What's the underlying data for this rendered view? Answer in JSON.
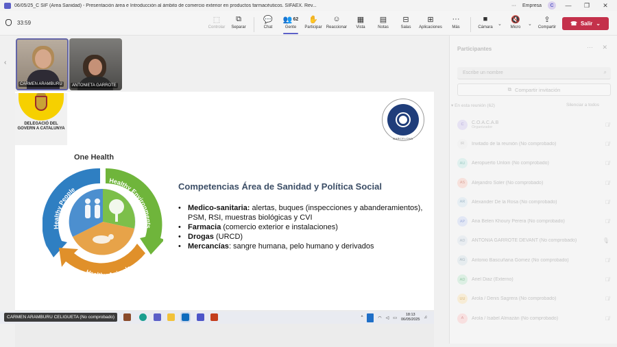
{
  "window": {
    "title": "06/05/25_C SIF (Área Sanidad) - Presentación área e Introducción al ámbito de comercio exterior en productos farmacéuticos. SIFAEX. Rev...",
    "org": "Empresa",
    "user_initial": "C"
  },
  "toolbar": {
    "timer": "33:59",
    "buttons": [
      {
        "label": "Controlar",
        "icon": "control-icon"
      },
      {
        "label": "Separar",
        "icon": "popout-icon"
      },
      {
        "label": "Chat",
        "icon": "chat-icon"
      },
      {
        "label": "Gente",
        "icon": "people-icon",
        "count": "62"
      },
      {
        "label": "Participar",
        "icon": "raise-hand-icon"
      },
      {
        "label": "Reaccionar",
        "icon": "react-icon"
      },
      {
        "label": "Vista",
        "icon": "view-icon"
      },
      {
        "label": "Notas",
        "icon": "notes-icon"
      },
      {
        "label": "Salas",
        "icon": "rooms-icon"
      },
      {
        "label": "Aplicaciones",
        "icon": "apps-icon"
      },
      {
        "label": "Más",
        "icon": "more-icon"
      },
      {
        "label": "Cámara",
        "icon": "camera-icon"
      },
      {
        "label": "Micro",
        "icon": "mic-muted-icon"
      },
      {
        "label": "Compartir",
        "icon": "share-icon"
      }
    ],
    "leave_label": "Salir"
  },
  "stage": {
    "participants": [
      {
        "name": "CARMEN ARAMBURU"
      },
      {
        "name": "ANTONIETA GARROTE"
      }
    ],
    "caption": "CARMEN ARAMBURU CELIGUETA (No comprobado)"
  },
  "slide": {
    "gov_logo_text": "DELEGACIÓ DEL GOVERN A CATALUNYA",
    "seal_text": "BARCELONA",
    "one_health_title": "One Health",
    "cycle_labels": [
      "Healthy People",
      "Healthy Environments",
      "Healthy Animals"
    ],
    "heading": "Competencias Área de Sanidad y Política Social",
    "bullets": [
      {
        "bold": "Medico-sanitaria:",
        "text": " alertas, buques (inspecciones y abanderamientos), PSM, RSI, muestras biológicas y CVI"
      },
      {
        "bold": "Farmacia",
        "text": " (comercio exterior e instalaciones)"
      },
      {
        "bold": "Drogas",
        "text": " (URCD)"
      },
      {
        "bold": "Mercancías",
        "text": ": sangre humana, pelo humano y derivados"
      }
    ]
  },
  "taskbar": {
    "time": "18:13",
    "date": "06/05/2025"
  },
  "panel": {
    "title": "Participantes",
    "search_placeholder": "Escribe un nombre",
    "share_invite": "Compartir invitación",
    "section": "En esta reunión (62)",
    "mute_all": "Silenciar a todos",
    "people": [
      {
        "initials": "C",
        "name": "C.O.A.C.A.B",
        "sub": "Organizador",
        "color": "#e6e2f3"
      },
      {
        "initials": "IR",
        "name": "Invitado de la reunión (No comprobado)",
        "sub": "",
        "color": "#f2f2f2"
      },
      {
        "initials": "AU",
        "name": "Aeropuerto Unloin (No comprobado)",
        "sub": "",
        "color": "#dff0ee"
      },
      {
        "initials": "AS",
        "name": "Alejandro Soler (No comprobado)",
        "sub": "",
        "color": "#f7e1dc"
      },
      {
        "initials": "AR",
        "name": "Alexander De la Rosa (No comprobado)",
        "sub": "",
        "color": "#e6eef3"
      },
      {
        "initials": "AP",
        "name": "Ana Belen Khoury Perera (No comprobado)",
        "sub": "",
        "color": "#e2e7f5"
      },
      {
        "initials": "AD",
        "name": "ANTONIA GARROTE DEVANT (No comprobado)",
        "sub": "",
        "color": "#e9edf1"
      },
      {
        "initials": "AG",
        "name": "Antonio Bascuñana Gomez (No comprobado)",
        "sub": "",
        "color": "#e6ecef"
      },
      {
        "initials": "AD",
        "name": "Ariel Diaz (Externo)",
        "sub": "",
        "color": "#dcefe3"
      },
      {
        "initials": "UU",
        "name": "Arola / Denis Sagrera (No comprobado)",
        "sub": "",
        "color": "#f7ecd6"
      },
      {
        "initials": "A",
        "name": "Arola / Isabel Almazán (No comprobado)",
        "sub": "",
        "color": "#f8e0e0"
      }
    ]
  }
}
